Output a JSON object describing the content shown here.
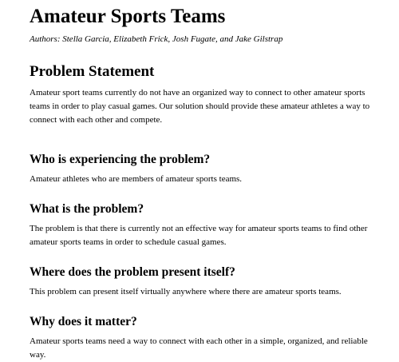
{
  "title": "Amateur Sports Teams",
  "authors": "Authors: Stella Garcia, Elizabeth Frick, Josh Fugate, and Jake Gilstrap",
  "problem_statement": {
    "heading": "Problem Statement",
    "text": "Amateur sport teams currently do not have an organized way to connect to other amateur sports teams in order to play casual games. Our solution should provide these amateur athletes a way to connect with each other and compete."
  },
  "sections": [
    {
      "heading": "Who is experiencing the problem?",
      "text": "Amateur athletes who are members of amateur sports teams."
    },
    {
      "heading": "What is the problem?",
      "text": "The problem is that there is currently not an effective way for amateur sports teams to find other amateur sports teams in order to schedule casual games."
    },
    {
      "heading": "Where does the problem present itself?",
      "text": "This problem can present itself virtually anywhere where there are amateur sports teams."
    },
    {
      "heading": "Why does it matter?",
      "text": "Amateur sports teams need a way to connect with each other in a simple, organized, and reliable way."
    }
  ]
}
